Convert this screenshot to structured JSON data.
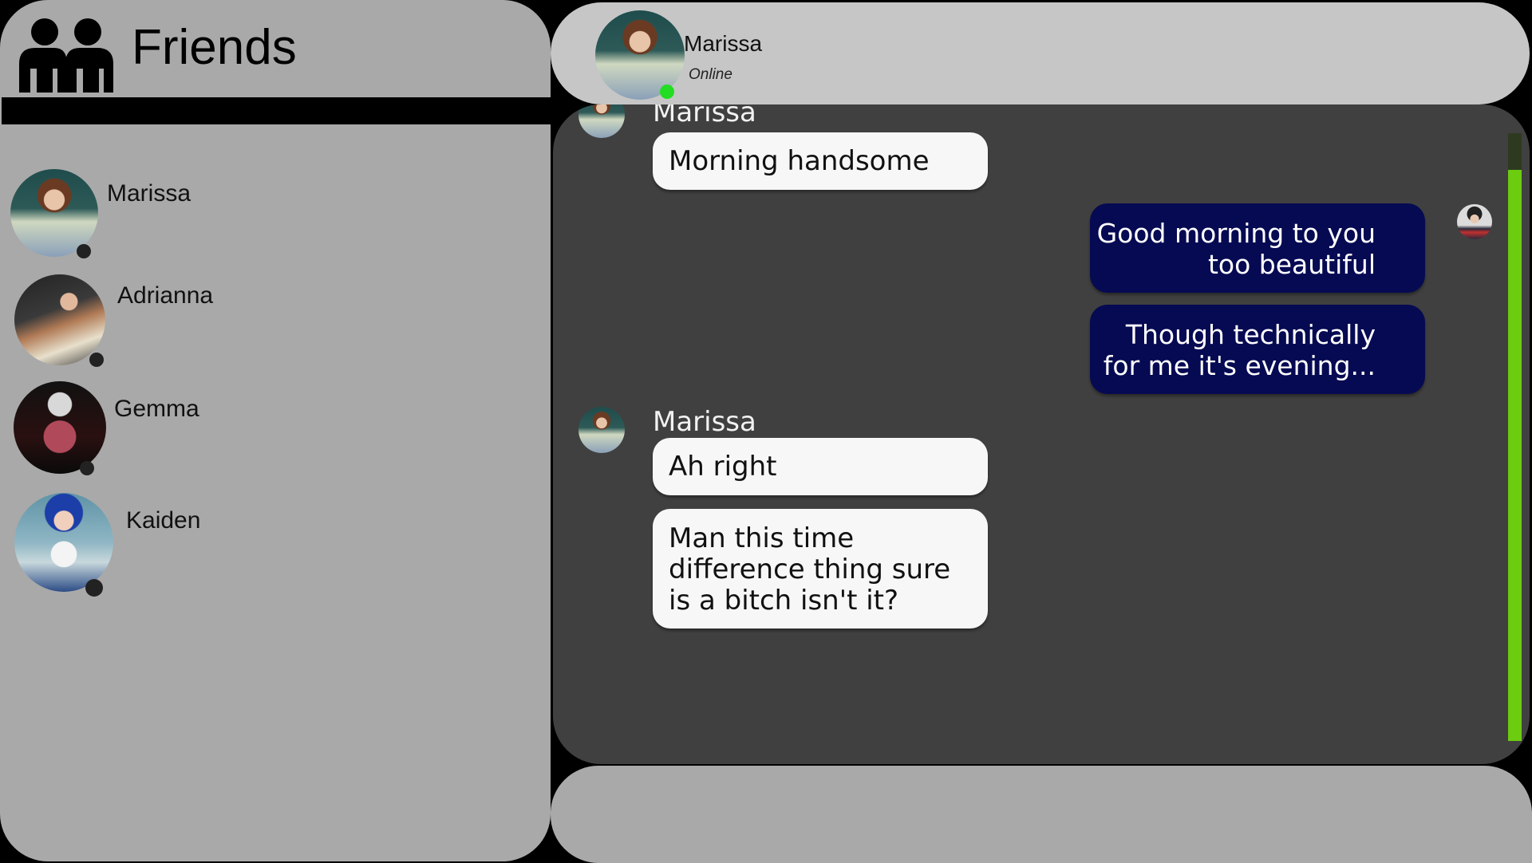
{
  "friends_panel": {
    "title": "Friends",
    "icon": "friends-icon",
    "friends": [
      {
        "name": "Marissa",
        "avatar": "portrait-marissa",
        "status": "offline"
      },
      {
        "name": "Adrianna",
        "avatar": "portrait-adrianna",
        "status": "offline"
      },
      {
        "name": "Gemma",
        "avatar": "portrait-gemma",
        "status": "offline"
      },
      {
        "name": "Kaiden",
        "avatar": "portrait-kaiden",
        "status": "offline"
      }
    ]
  },
  "chat_header": {
    "contact_name": "Marissa",
    "status_text": "Online",
    "status_color": "#22dd22"
  },
  "chat": {
    "messages": [
      {
        "sender": "Marissa",
        "direction": "in",
        "text": "Morning handsome"
      },
      {
        "sender": "player",
        "direction": "out",
        "text_lines": [
          "Good morning to you",
          "too beautiful"
        ]
      },
      {
        "sender": "player",
        "direction": "out",
        "text_lines": [
          "Though technically",
          "for me it's evening..."
        ]
      },
      {
        "sender": "Marissa",
        "direction": "in",
        "text": "Ah right"
      },
      {
        "sender": "Marissa",
        "direction": "in",
        "text_lines": [
          "Man this time",
          "difference thing sure",
          "is a bitch isn't it?"
        ]
      }
    ],
    "sender_labels": [
      "Marissa",
      "Marissa"
    ],
    "incoming_bubble_color": "#f7f7f7",
    "outgoing_bubble_color": "#060a52",
    "scrollbar_color": "#6ccc10"
  },
  "input_bar": {
    "placeholder": ""
  }
}
